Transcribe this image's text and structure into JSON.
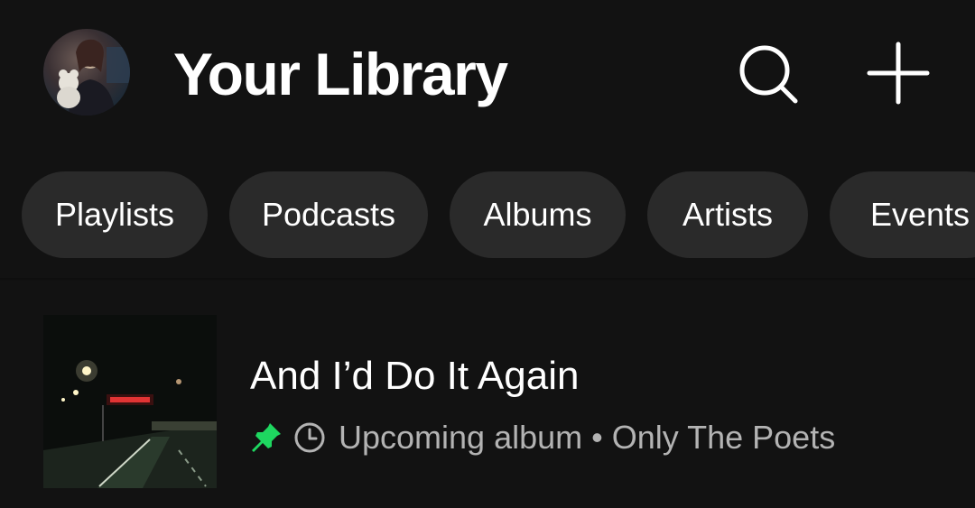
{
  "header": {
    "title": "Your Library",
    "avatar_icon": "user-avatar",
    "search_icon": "search-icon",
    "add_icon": "plus-icon"
  },
  "filters": [
    {
      "label": "Playlists"
    },
    {
      "label": "Podcasts"
    },
    {
      "label": "Albums"
    },
    {
      "label": "Artists"
    },
    {
      "label": "Events"
    }
  ],
  "library": {
    "items": [
      {
        "title": "And I’d Do It Again",
        "pinned": true,
        "status_icon": "clock-icon",
        "type": "Upcoming album",
        "separator": "•",
        "artist": "Only The Poets",
        "pin_color": "#1ed760"
      }
    ]
  },
  "colors": {
    "background": "#121212",
    "chip_bg": "#2a2a2a",
    "accent": "#1ed760",
    "secondary_text": "#b3b3b3"
  }
}
